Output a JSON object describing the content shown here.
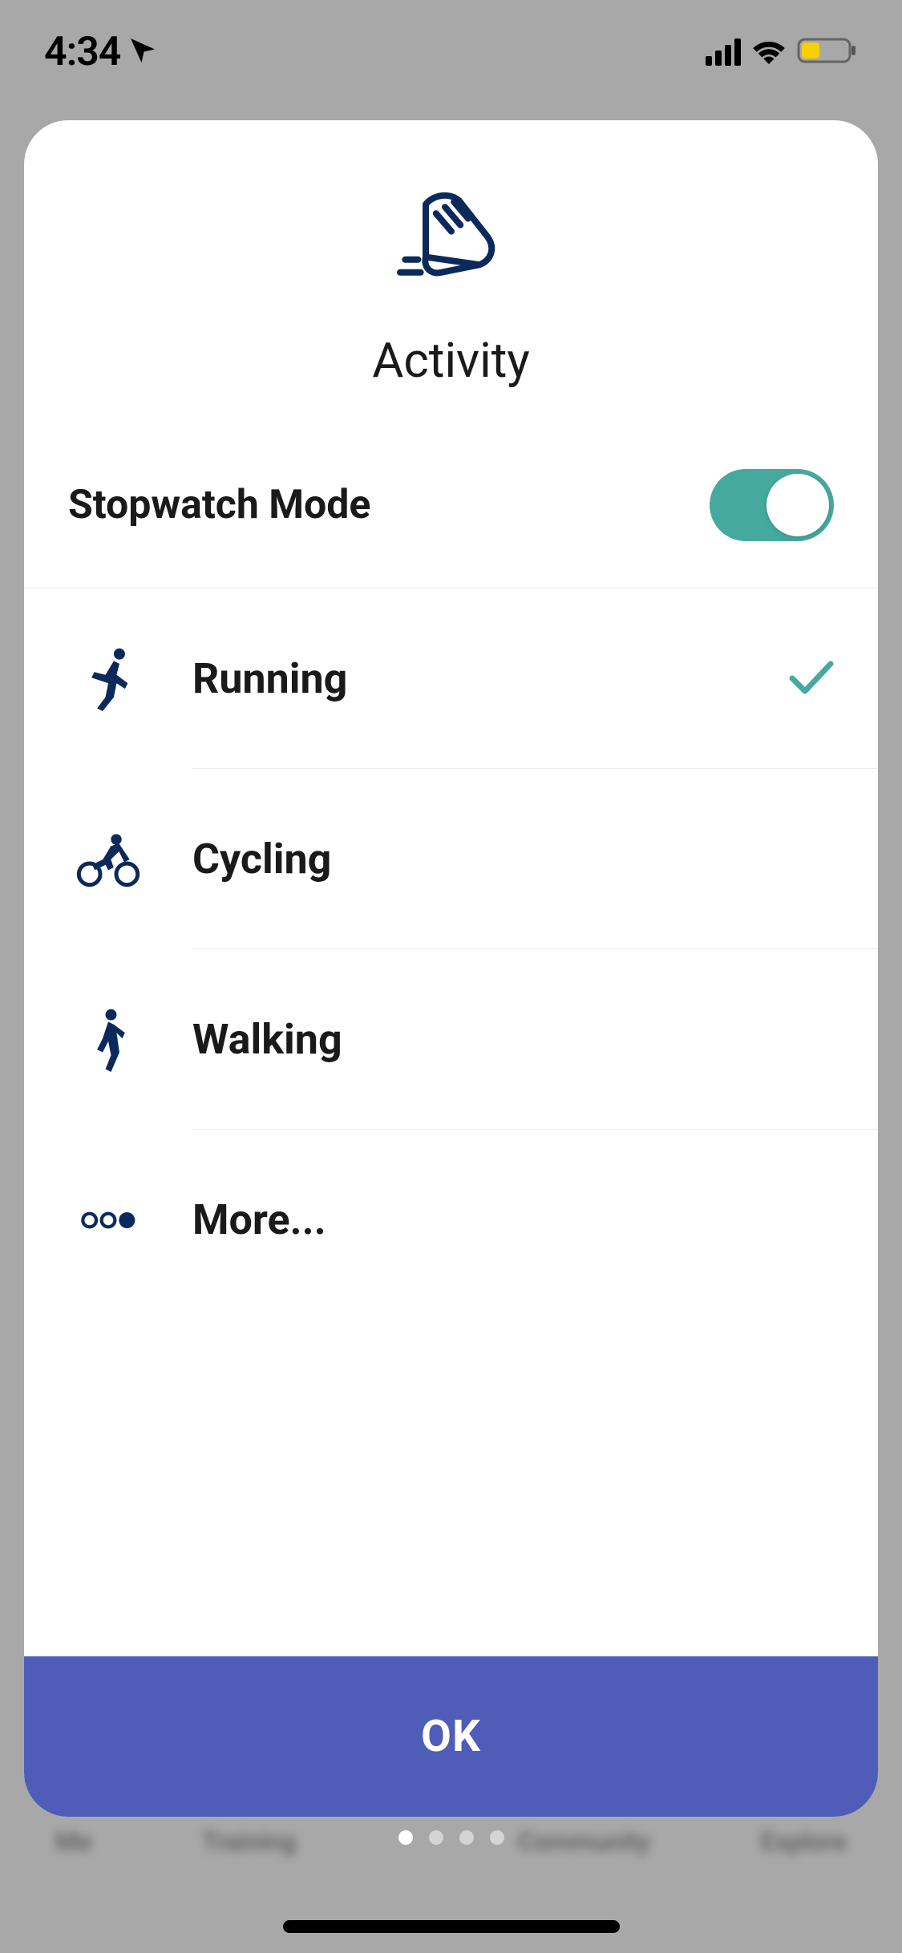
{
  "status_bar": {
    "time": "4:34"
  },
  "modal": {
    "title": "Activity",
    "stopwatch_label": "Stopwatch Mode",
    "stopwatch_on": true,
    "activities": [
      {
        "key": "running",
        "label": "Running",
        "selected": true
      },
      {
        "key": "cycling",
        "label": "Cycling",
        "selected": false
      },
      {
        "key": "walking",
        "label": "Walking",
        "selected": false
      },
      {
        "key": "more",
        "label": "More...",
        "selected": false
      }
    ],
    "ok_label": "OK"
  },
  "colors": {
    "accent_teal": "#45a99f",
    "accent_blue": "#4f5cb8",
    "icon_navy": "#0b2a5b"
  },
  "bg_nav": {
    "items": [
      "Me",
      "Training",
      "",
      "Community",
      "Explore"
    ]
  }
}
